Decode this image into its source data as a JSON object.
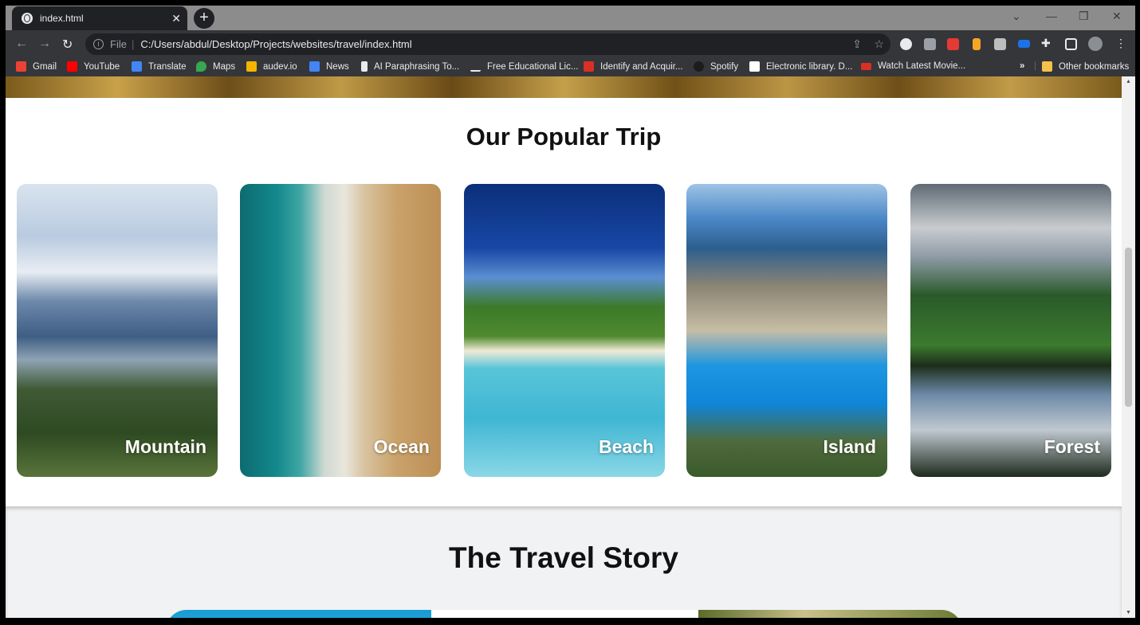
{
  "browser": {
    "tab_title": "index.html",
    "tab_close": "✕",
    "new_tab": "+",
    "url_scheme": "File",
    "url": "C:/Users/abdul/Desktop/Projects/websites/travel/index.html",
    "bookmarks": [
      {
        "label": "Gmail",
        "color": "#ea4335"
      },
      {
        "label": "YouTube",
        "color": "#ff0000"
      },
      {
        "label": "Translate",
        "color": "#4285f4"
      },
      {
        "label": "Maps",
        "color": "#34a853"
      },
      {
        "label": "audev.io",
        "color": "#f4b400"
      },
      {
        "label": "News",
        "color": "#4285f4"
      },
      {
        "label": "AI Paraphrasing To...",
        "color": "#e8eaed"
      },
      {
        "label": "Free Educational Lic...",
        "color": "#202124"
      },
      {
        "label": "Identify and Acquir...",
        "color": "#d93025"
      },
      {
        "label": "Spotify",
        "color": "#1c1c1c"
      },
      {
        "label": "Electronic library. D...",
        "color": "#ffffff"
      },
      {
        "label": "Watch Latest Movie...",
        "color": "#d93025"
      }
    ],
    "overflow": "»",
    "other_bookmarks": "Other bookmarks"
  },
  "page": {
    "popular_title": "Our Popular Trip",
    "trips": [
      {
        "label": "Mountain"
      },
      {
        "label": "Ocean"
      },
      {
        "label": "Beach"
      },
      {
        "label": "Island"
      },
      {
        "label": "Forest"
      }
    ],
    "story_title": "The Travel Story"
  }
}
